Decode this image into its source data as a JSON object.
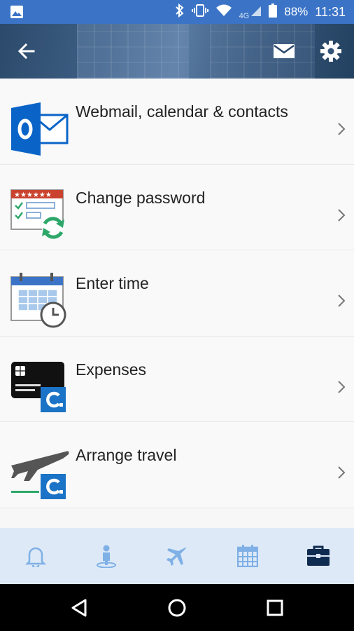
{
  "status_bar": {
    "network": "4G",
    "battery": "88%",
    "time": "11:31"
  },
  "header": {
    "back_icon": "arrow-left-icon",
    "mail_icon": "envelope-icon",
    "settings_icon": "gear-icon"
  },
  "menu": {
    "items": [
      {
        "label": "Webmail, calendar & contacts",
        "icon": "outlook-icon"
      },
      {
        "label": "Change password",
        "icon": "password-refresh-icon"
      },
      {
        "label": "Enter time",
        "icon": "timesheet-clock-icon"
      },
      {
        "label": "Expenses",
        "icon": "credit-card-icon"
      },
      {
        "label": "Arrange travel",
        "icon": "airplane-icon"
      }
    ]
  },
  "tabs": [
    {
      "name": "notifications",
      "icon": "bell-icon",
      "active": false
    },
    {
      "name": "profile",
      "icon": "person-icon",
      "active": false
    },
    {
      "name": "travel",
      "icon": "airplane-icon",
      "active": false
    },
    {
      "name": "calendar",
      "icon": "calendar-icon",
      "active": false
    },
    {
      "name": "tools",
      "icon": "briefcase-icon",
      "active": true
    }
  ],
  "colors": {
    "status_bar": "#3b74c6",
    "tab_bar": "#dde9f7",
    "tab_inactive": "#7fb0e6",
    "tab_active": "#0f2b4f",
    "outlook_blue": "#0a64c8",
    "concur_blue": "#1a73c6",
    "green": "#2ea86a",
    "red": "#c9432f"
  }
}
